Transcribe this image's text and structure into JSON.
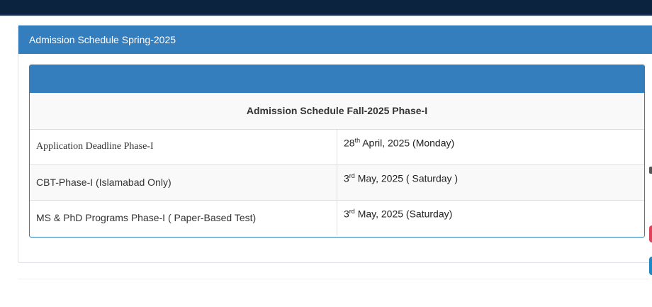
{
  "panel": {
    "heading": "Admission Schedule Spring-2025"
  },
  "schedule": {
    "title": "Admission Schedule Fall-2025 Phase-I",
    "rows": [
      {
        "event": "Application Deadline Phase-I",
        "day": "28",
        "suffix": "th",
        "rest": " April, 2025 (Monday)"
      },
      {
        "event": "CBT-Phase-I (Islamabad Only)",
        "day": "3",
        "suffix": "rd",
        "rest": " May, 2025 ( Saturday )"
      },
      {
        "event": "MS & PhD Programs Phase-I ( Paper-Based Test)",
        "day": "3",
        "suffix": "rd",
        "rest": " May, 2025 (Saturday)"
      }
    ]
  },
  "colors": {
    "header_blue": "#357ebd",
    "topbar": "#0c2340"
  }
}
